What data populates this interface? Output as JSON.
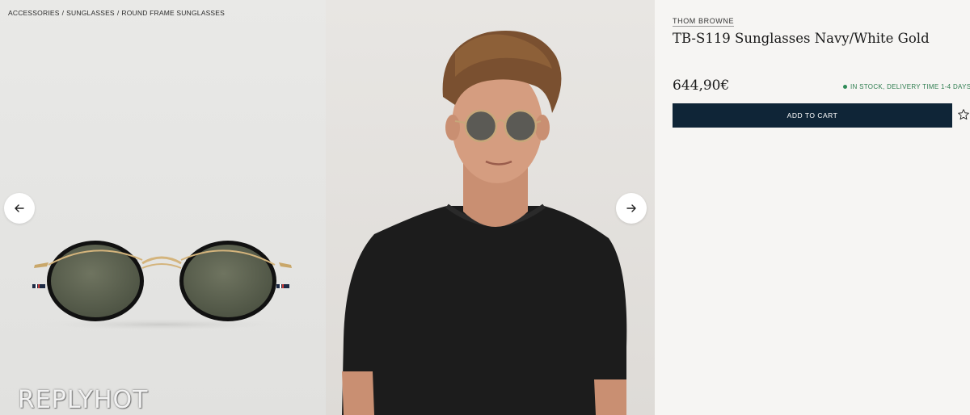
{
  "breadcrumb": {
    "items": [
      "Accessories",
      "Sunglasses",
      "Round Frame Sunglasses"
    ],
    "separator": "/"
  },
  "gallery": {
    "prev_icon": "arrow-left-icon",
    "next_icon": "arrow-right-icon",
    "images": [
      "product-sunglasses-image",
      "model-wearing-sunglasses-image"
    ]
  },
  "watermark": "REPLYHOT",
  "product": {
    "brand": "THOM BROWNE",
    "title": "TB-S119 Sunglasses Navy/White Gold",
    "price": "644,90€",
    "stock_status": "IN STOCK, DELIVERY TIME 1-4 DAYS",
    "add_to_cart_label": "ADD TO CART",
    "wishlist_icon": "star-outline-icon"
  },
  "colors": {
    "cart_button": "#0f2537",
    "stock_green": "#2e7d4f",
    "page_background": "#f6f5f3"
  }
}
